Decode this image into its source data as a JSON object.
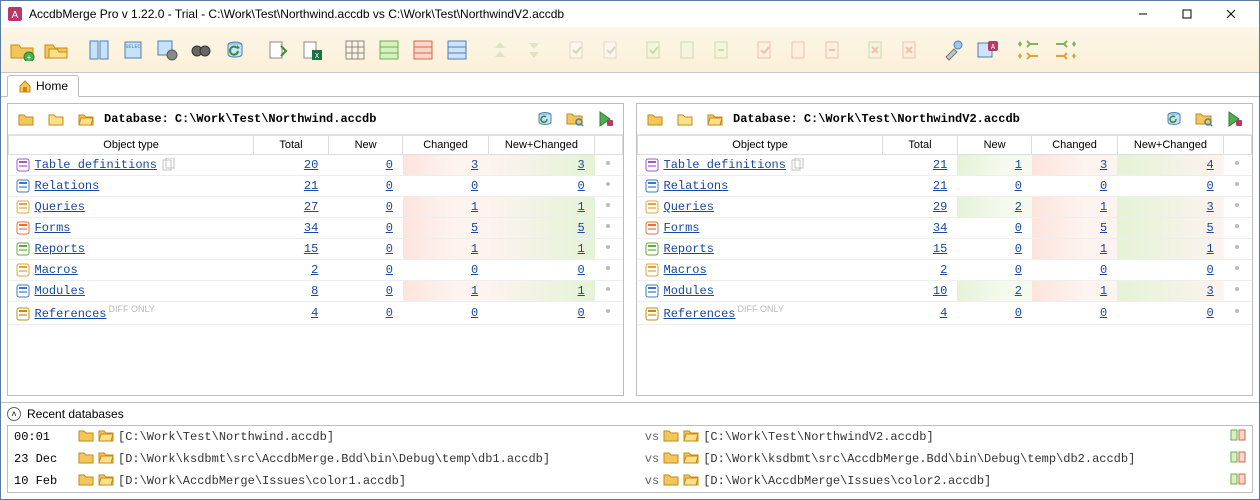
{
  "window": {
    "title": "AccdbMerge Pro v 1.22.0 - Trial - C:\\Work\\Test\\Northwind.accdb vs C:\\Work\\Test\\NorthwindV2.accdb"
  },
  "tab": {
    "label": "Home"
  },
  "left": {
    "label": "Database:",
    "path": "C:\\Work\\Test\\Northwind.accdb",
    "headers": {
      "type": "Object type",
      "total": "Total",
      "new": "New",
      "changed": "Changed",
      "nc": "New+Changed"
    },
    "rows": [
      {
        "name": "Table definitions",
        "diffonly": false,
        "copyable": true,
        "total": "20",
        "new": "0",
        "changed": "3",
        "nc": "3",
        "nflag": false,
        "cflag": true,
        "ncflag": true
      },
      {
        "name": "Relations",
        "diffonly": false,
        "copyable": false,
        "total": "21",
        "new": "0",
        "changed": "0",
        "nc": "0",
        "nflag": false,
        "cflag": false,
        "ncflag": false
      },
      {
        "name": "Queries",
        "diffonly": false,
        "copyable": false,
        "total": "27",
        "new": "0",
        "changed": "1",
        "nc": "1",
        "nflag": false,
        "cflag": true,
        "ncflag": true
      },
      {
        "name": "Forms",
        "diffonly": false,
        "copyable": false,
        "total": "34",
        "new": "0",
        "changed": "5",
        "nc": "5",
        "nflag": false,
        "cflag": true,
        "ncflag": true
      },
      {
        "name": "Reports",
        "diffonly": false,
        "copyable": false,
        "total": "15",
        "new": "0",
        "changed": "1",
        "nc": "1",
        "nflag": false,
        "cflag": true,
        "ncflag": true
      },
      {
        "name": "Macros",
        "diffonly": false,
        "copyable": false,
        "total": "2",
        "new": "0",
        "changed": "0",
        "nc": "0",
        "nflag": false,
        "cflag": false,
        "ncflag": false
      },
      {
        "name": "Modules",
        "diffonly": false,
        "copyable": false,
        "total": "8",
        "new": "0",
        "changed": "1",
        "nc": "1",
        "nflag": false,
        "cflag": true,
        "ncflag": true
      },
      {
        "name": "References",
        "diffonly": true,
        "copyable": false,
        "total": "4",
        "new": "0",
        "changed": "0",
        "nc": "0",
        "nflag": false,
        "cflag": false,
        "ncflag": false
      }
    ]
  },
  "right": {
    "label": "Database:",
    "path": "C:\\Work\\Test\\NorthwindV2.accdb",
    "headers": {
      "type": "Object type",
      "total": "Total",
      "new": "New",
      "changed": "Changed",
      "nc": "New+Changed"
    },
    "rows": [
      {
        "name": "Table definitions",
        "diffonly": false,
        "copyable": true,
        "total": "21",
        "new": "1",
        "changed": "3",
        "nc": "4",
        "nflag": true,
        "cflag": true,
        "ncflag": true
      },
      {
        "name": "Relations",
        "diffonly": false,
        "copyable": false,
        "total": "21",
        "new": "0",
        "changed": "0",
        "nc": "0",
        "nflag": false,
        "cflag": false,
        "ncflag": false
      },
      {
        "name": "Queries",
        "diffonly": false,
        "copyable": false,
        "total": "29",
        "new": "2",
        "changed": "1",
        "nc": "3",
        "nflag": true,
        "cflag": true,
        "ncflag": true
      },
      {
        "name": "Forms",
        "diffonly": false,
        "copyable": false,
        "total": "34",
        "new": "0",
        "changed": "5",
        "nc": "5",
        "nflag": false,
        "cflag": true,
        "ncflag": true
      },
      {
        "name": "Reports",
        "diffonly": false,
        "copyable": false,
        "total": "15",
        "new": "0",
        "changed": "1",
        "nc": "1",
        "nflag": false,
        "cflag": true,
        "ncflag": true
      },
      {
        "name": "Macros",
        "diffonly": false,
        "copyable": false,
        "total": "2",
        "new": "0",
        "changed": "0",
        "nc": "0",
        "nflag": false,
        "cflag": false,
        "ncflag": false
      },
      {
        "name": "Modules",
        "diffonly": false,
        "copyable": false,
        "total": "10",
        "new": "2",
        "changed": "1",
        "nc": "3",
        "nflag": true,
        "cflag": true,
        "ncflag": true
      },
      {
        "name": "References",
        "diffonly": true,
        "copyable": false,
        "total": "4",
        "new": "0",
        "changed": "0",
        "nc": "0",
        "nflag": false,
        "cflag": false,
        "ncflag": false
      }
    ]
  },
  "recent": {
    "title": "Recent databases",
    "diffonly_label": "DIFF ONLY",
    "vs_label": "vs",
    "rows": [
      {
        "ts": "00:01",
        "left": "[C:\\Work\\Test\\Northwind.accdb]",
        "right": "[C:\\Work\\Test\\NorthwindV2.accdb]"
      },
      {
        "ts": "23 Dec",
        "left": "[D:\\Work\\ksdbmt\\src\\AccdbMerge.Bdd\\bin\\Debug\\temp\\db1.accdb]",
        "right": "[D:\\Work\\ksdbmt\\src\\AccdbMerge.Bdd\\bin\\Debug\\temp\\db2.accdb]"
      },
      {
        "ts": "10 Feb",
        "left": "[D:\\Work\\AccdbMerge\\Issues\\color1.accdb]",
        "right": "[D:\\Work\\AccdbMerge\\Issues\\color2.accdb]"
      }
    ]
  }
}
